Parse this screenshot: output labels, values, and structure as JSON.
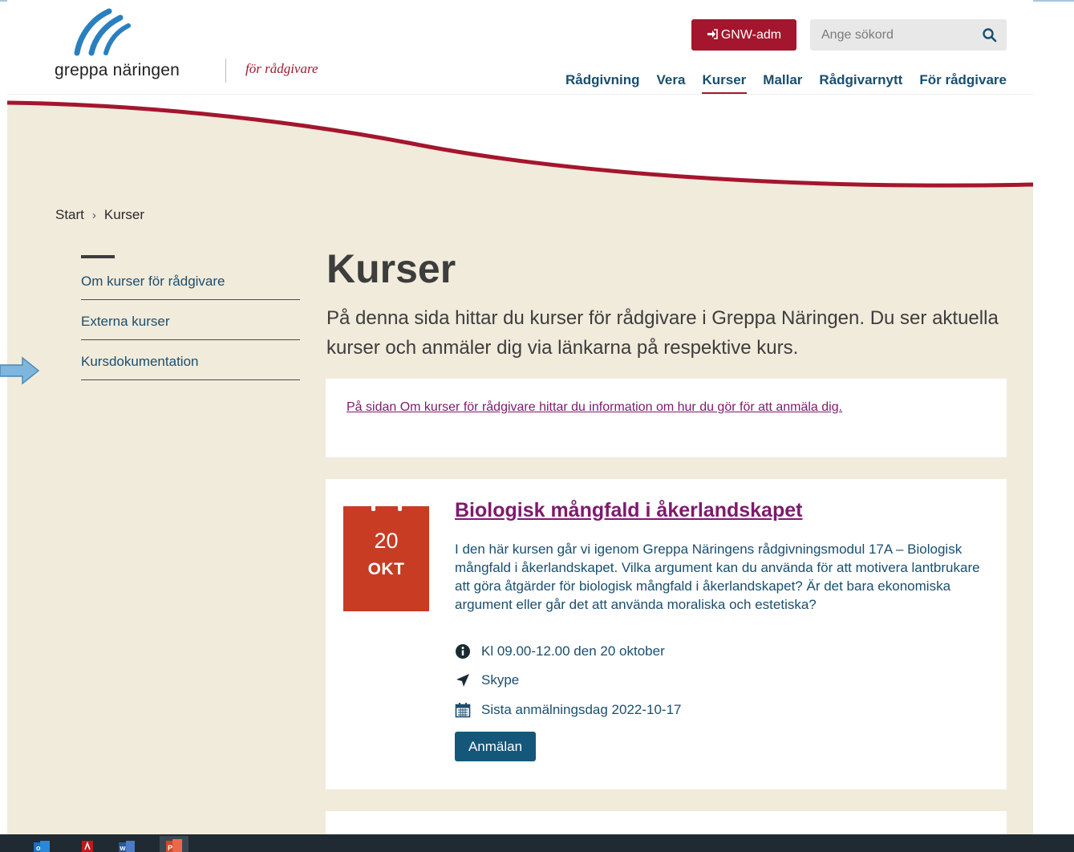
{
  "header": {
    "logo_text": "greppa näringen",
    "logo_tagline": "för rådgivare",
    "admin_button_label": "GNW-adm",
    "search_placeholder": "Ange sökord",
    "nav": [
      "Rådgivning",
      "Vera",
      "Kurser",
      "Mallar",
      "Rådgivarnytt",
      "För rådgivare"
    ],
    "active_nav": "Kurser"
  },
  "breadcrumb": {
    "start": "Start",
    "separator": "›",
    "current": "Kurser"
  },
  "side_menu": [
    "Om kurser för rådgivare",
    "Externa kurser",
    "Kursdokumentation"
  ],
  "page": {
    "title": "Kurser",
    "intro": "På denna sida hittar du kurser för rådgivare i Greppa Näringen. Du ser aktuella kurser och anmäler dig via länkarna på respektive kurs.",
    "info_link": "På sidan Om kurser för rådgivare hittar du information om hur du gör för att anmäla dig."
  },
  "course": {
    "day": "20",
    "month": "OKT",
    "title": "Biologisk mångfald i åkerlandskapet",
    "description": "I den här kursen går vi igenom Greppa Näringens rådgivningsmodul 17A – Biologisk mångfald i åkerlandskapet. Vilka argument kan du använda för att motivera lantbrukare att göra åtgärder för biologisk mångfald i åkerlandskapet? Är det bara ekonomiska argument eller går det att använda moraliska och estetiska?",
    "time": "Kl 09.00-12.00 den 20 oktober",
    "location": "Skype",
    "deadline": "Sista anmälningsdag 2022-10-17",
    "register_label": "Anmälan"
  },
  "colors": {
    "brand_red": "#a4162e",
    "nav_blue": "#1a4e6e",
    "link_purple": "#7d1a6e",
    "calendar_orange": "#c73c23",
    "beige": "#f1ebdc",
    "button_blue": "#14577a"
  },
  "icons": {
    "admin": "sign-in-icon",
    "search": "search-icon",
    "time": "info-circle-icon",
    "location": "location-arrow-icon",
    "deadline": "calendar-icon"
  }
}
